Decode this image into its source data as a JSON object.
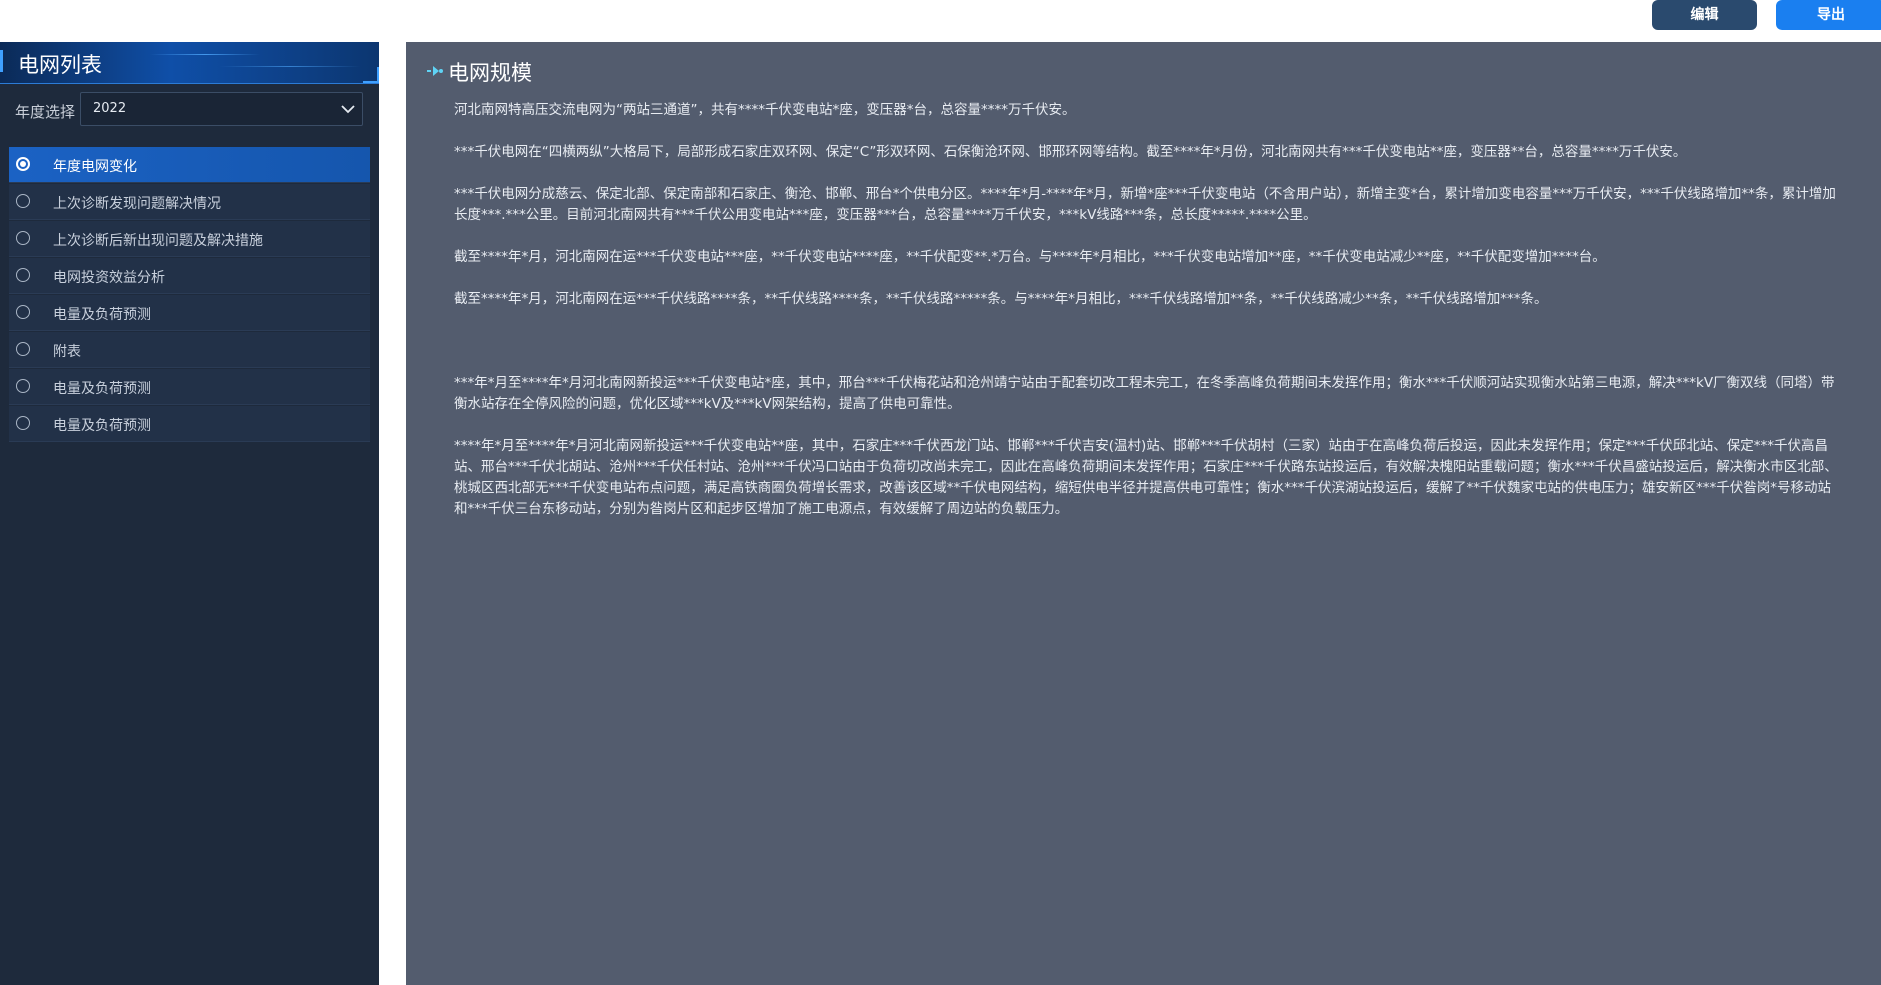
{
  "toolbar": {
    "edit_label": "编辑",
    "export_label": "导出",
    "edit_color": "#2a4a6e",
    "export_color": "#1a7ff0"
  },
  "sidebar": {
    "title": "电网列表",
    "year_label": "年度选择",
    "year_value": "2022",
    "items": [
      {
        "label": "年度电网变化",
        "active": true
      },
      {
        "label": "上次诊断发现问题解决情况",
        "active": false
      },
      {
        "label": "上次诊断后新出现问题及解决措施",
        "active": false
      },
      {
        "label": "电网投资效益分析",
        "active": false
      },
      {
        "label": "电量及负荷预测",
        "active": false
      },
      {
        "label": "附表",
        "active": false
      },
      {
        "label": "电量及负荷预测",
        "active": false
      },
      {
        "label": "电量及负荷预测",
        "active": false
      }
    ],
    "active_color": "#1b62c4"
  },
  "main": {
    "title": "电网规模",
    "paragraphs": [
      "河北南网特高压交流电网为“两站三通道”，共有****千伏变电站*座，变压器*台，总容量****万千伏安。",
      "***千伏电网在“四横两纵”大格局下，局部形成石家庄双环网、保定“C”形双环网、石保衡沧环网、邯邢环网等结构。截至****年*月份，河北南网共有***千伏变电站**座，变压器**台，总容量****万千伏安。",
      "***千伏电网分成慈云、保定北部、保定南部和石家庄、衡沧、邯郸、邢台*个供电分区。****年*月-****年*月，新增*座***千伏变电站（不含用户站），新增主变*台，累计增加变电容量***万千伏安，***千伏线路增加**条，累计增加长度***.***公里。目前河北南网共有***千伏公用变电站***座，变压器***台，总容量****万千伏安，***kV线路***条，总长度*****.****公里。",
      "截至****年*月，河北南网在运***千伏变电站***座，**千伏变电站****座，**千伏配变**.*万台。与****年*月相比，***千伏变电站增加**座，**千伏变电站减少**座，**千伏配变增加****台。",
      "截至****年*月，河北南网在运***千伏线路****条，**千伏线路****条，**千伏线路*****条。与****年*月相比，***千伏线路增加**条，**千伏线路减少**条，**千伏线路增加***条。",
      "***年*月至****年*月河北南网新投运***千伏变电站*座，其中，邢台***千伏梅花站和沧州靖宁站由于配套切改工程未完工，在冬季高峰负荷期间未发挥作用；衡水***千伏顺河站实现衡水站第三电源，解决***kV厂衡双线（同塔）带衡水站存在全停风险的问题，优化区域***kV及***kV网架结构，提高了供电可靠性。",
      "****年*月至****年*月河北南网新投运***千伏变电站**座，其中，石家庄***千伏西龙门站、邯郸***千伏吉安(温村)站、邯郸***千伏胡村（三家）站由于在高峰负荷后投运，因此未发挥作用；保定***千伏邱北站、保定***千伏高昌站、邢台***千伏北胡站、沧州***千伏任村站、沧州***千伏冯口站由于负荷切改尚未完工，因此在高峰负荷期间未发挥作用；石家庄***千伏路东站投运后，有效解决槐阳站重载问题；衡水***千伏昌盛站投运后，解决衡水市区北部、桃城区西北部无***千伏变电站布点问题，满足高铁商圈负荷增长需求，改善该区域**千伏电网结构，缩短供电半径并提高供电可靠性；衡水***千伏滨湖站投运后，缓解了**千伏魏家屯站的供电压力；雄安新区***千伏昝岗*号移动站和***千伏三台东移动站，分别为昝岗片区和起步区增加了施工电源点，有效缓解了周边站的负载压力。"
    ]
  }
}
